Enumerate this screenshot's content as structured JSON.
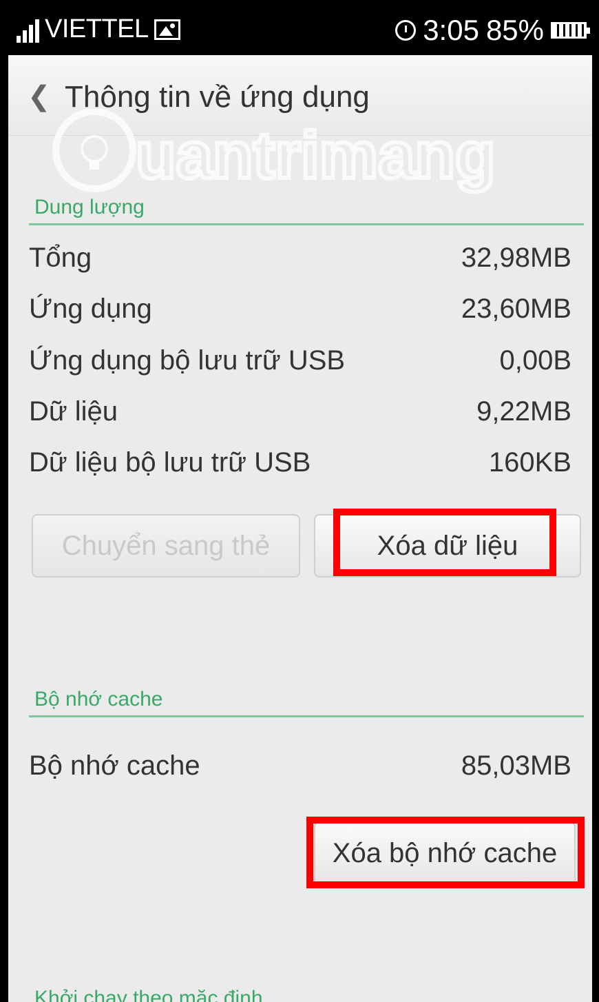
{
  "status_bar": {
    "carrier": "VIETTEL",
    "time": "3:05",
    "battery": "85%"
  },
  "header": {
    "title": "Thông tin về ứng dụng"
  },
  "storage": {
    "section_label": "Dung lượng",
    "rows": [
      {
        "label": "Tổng",
        "value": "32,98MB"
      },
      {
        "label": "Ứng dụng",
        "value": "23,60MB"
      },
      {
        "label": "Ứng dụng bộ lưu trữ USB",
        "value": "0,00B"
      },
      {
        "label": "Dữ liệu",
        "value": "9,22MB"
      },
      {
        "label": "Dữ liệu bộ lưu trữ USB",
        "value": "160KB"
      }
    ],
    "move_button": "Chuyển sang thẻ",
    "clear_data_button": "Xóa dữ liệu"
  },
  "cache": {
    "section_label": "Bộ nhớ cache",
    "row_label": "Bộ nhớ cache",
    "row_value": "85,03MB",
    "clear_cache_button": "Xóa bộ nhớ cache"
  },
  "launch": {
    "section_label": "Khởi chạy theo mặc định"
  },
  "watermark": "uantrimang",
  "colors": {
    "accent_green": "#3aa868",
    "highlight_red": "#ff0000"
  }
}
